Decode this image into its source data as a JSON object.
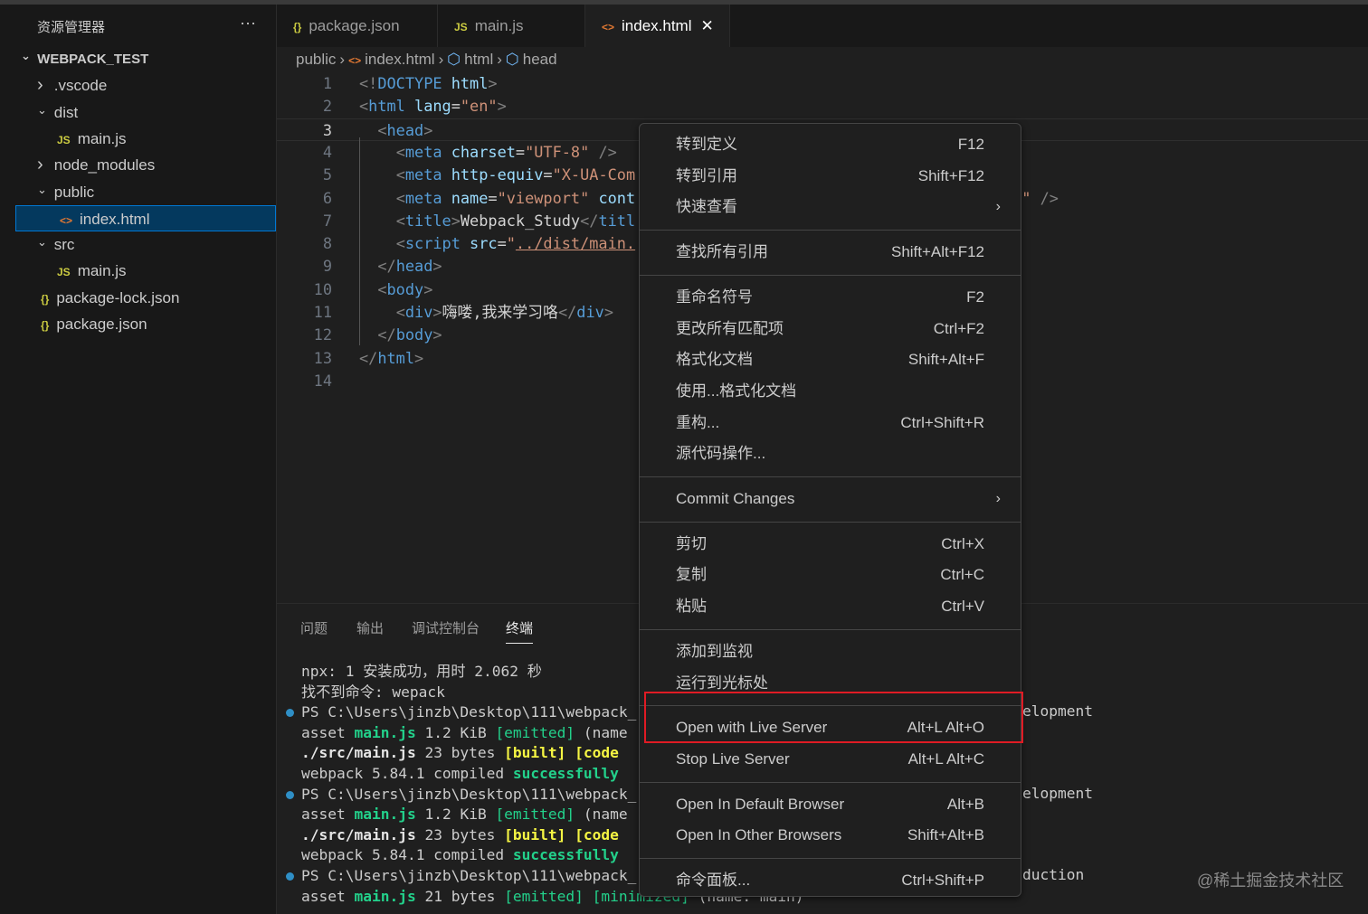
{
  "sidebar": {
    "title": "资源管理器",
    "more": "···",
    "tree": [
      {
        "label": "WEBPACK_TEST",
        "chevron": "down",
        "indent": 0,
        "root": true
      },
      {
        "label": ".vscode",
        "chevron": "right",
        "indent": 1
      },
      {
        "label": "dist",
        "chevron": "down",
        "indent": 1
      },
      {
        "label": "main.js",
        "icon": "JS",
        "iconType": "js",
        "indent": 2
      },
      {
        "label": "node_modules",
        "chevron": "right",
        "indent": 1
      },
      {
        "label": "public",
        "chevron": "down",
        "indent": 1
      },
      {
        "label": "index.html",
        "icon": "<>",
        "iconType": "html",
        "indent": 2,
        "selected": true
      },
      {
        "label": "src",
        "chevron": "down",
        "indent": 1
      },
      {
        "label": "main.js",
        "icon": "JS",
        "iconType": "js",
        "indent": 2
      },
      {
        "label": "package-lock.json",
        "icon": "{}",
        "iconType": "json",
        "indent": 1
      },
      {
        "label": "package.json",
        "icon": "{}",
        "iconType": "json",
        "indent": 1
      }
    ]
  },
  "tabs": [
    {
      "label": "package.json",
      "icon": "{}",
      "iconType": "json"
    },
    {
      "label": "main.js",
      "icon": "JS",
      "iconType": "js"
    },
    {
      "label": "index.html",
      "icon": "<>",
      "iconType": "html",
      "active": true,
      "close": "✕"
    }
  ],
  "breadcrumb": {
    "items": [
      "public",
      "index.html",
      "html",
      "head"
    ],
    "sep": "›"
  },
  "editor": {
    "current_line": 3,
    "lines": [
      [
        [
          "t-p",
          "<!"
        ],
        [
          "t-tag",
          "DOCTYPE"
        ],
        [
          "t-txt",
          " "
        ],
        [
          "t-attr",
          "html"
        ],
        [
          "t-p",
          ">"
        ]
      ],
      [
        [
          "t-p",
          "<"
        ],
        [
          "t-tag",
          "html"
        ],
        [
          "t-txt",
          " "
        ],
        [
          "t-attr",
          "lang"
        ],
        [
          "t-txt",
          "="
        ],
        [
          "t-str",
          "\"en\""
        ],
        [
          "t-p",
          ">"
        ]
      ],
      [
        [
          "t-txt",
          "  "
        ],
        [
          "t-p",
          "<"
        ],
        [
          "t-tag",
          "head"
        ],
        [
          "t-p",
          ">"
        ]
      ],
      [
        [
          "t-txt",
          "    "
        ],
        [
          "t-p",
          "<"
        ],
        [
          "t-tag",
          "meta"
        ],
        [
          "t-txt",
          " "
        ],
        [
          "t-attr",
          "charset"
        ],
        [
          "t-txt",
          "="
        ],
        [
          "t-str",
          "\"UTF-8\""
        ],
        [
          "t-txt",
          " "
        ],
        [
          "t-p",
          "/>"
        ]
      ],
      [
        [
          "t-txt",
          "    "
        ],
        [
          "t-p",
          "<"
        ],
        [
          "t-tag",
          "meta"
        ],
        [
          "t-txt",
          " "
        ],
        [
          "t-attr",
          "http-equiv"
        ],
        [
          "t-txt",
          "="
        ],
        [
          "t-str",
          "\"X-UA-Com"
        ]
      ],
      [
        [
          "t-txt",
          "    "
        ],
        [
          "t-p",
          "<"
        ],
        [
          "t-tag",
          "meta"
        ],
        [
          "t-txt",
          " "
        ],
        [
          "t-attr",
          "name"
        ],
        [
          "t-txt",
          "="
        ],
        [
          "t-str",
          "\"viewport\""
        ],
        [
          "t-txt",
          " "
        ],
        [
          "t-attr",
          "cont"
        ],
        [
          "t-txt",
          "                                         "
        ],
        [
          "t-str",
          "0\""
        ],
        [
          "t-txt",
          " "
        ],
        [
          "t-p",
          "/>"
        ]
      ],
      [
        [
          "t-txt",
          "    "
        ],
        [
          "t-p",
          "<"
        ],
        [
          "t-tag",
          "title"
        ],
        [
          "t-p",
          ">"
        ],
        [
          "t-txt",
          "Webpack_Study"
        ],
        [
          "t-p",
          "</"
        ],
        [
          "t-tag",
          "titl"
        ]
      ],
      [
        [
          "t-txt",
          "    "
        ],
        [
          "t-p",
          "<"
        ],
        [
          "t-tag",
          "script"
        ],
        [
          "t-txt",
          " "
        ],
        [
          "t-attr",
          "src"
        ],
        [
          "t-txt",
          "="
        ],
        [
          "t-str",
          "\""
        ],
        [
          "t-strU",
          "../dist/main."
        ]
      ],
      [
        [
          "t-txt",
          "  "
        ],
        [
          "t-p",
          "</"
        ],
        [
          "t-tag",
          "head"
        ],
        [
          "t-p",
          ">"
        ]
      ],
      [
        [
          "t-txt",
          "  "
        ],
        [
          "t-p",
          "<"
        ],
        [
          "t-tag",
          "body"
        ],
        [
          "t-p",
          ">"
        ]
      ],
      [
        [
          "t-txt",
          "    "
        ],
        [
          "t-p",
          "<"
        ],
        [
          "t-tag",
          "div"
        ],
        [
          "t-p",
          ">"
        ],
        [
          "t-txt",
          "嗨喽,我来学习咯"
        ],
        [
          "t-p",
          "</"
        ],
        [
          "t-tag",
          "div"
        ],
        [
          "t-p",
          ">"
        ]
      ],
      [
        [
          "t-txt",
          "  "
        ],
        [
          "t-p",
          "</"
        ],
        [
          "t-tag",
          "body"
        ],
        [
          "t-p",
          ">"
        ]
      ],
      [
        [
          "t-p",
          "</"
        ],
        [
          "t-tag",
          "html"
        ],
        [
          "t-p",
          ">"
        ]
      ],
      []
    ]
  },
  "panel": {
    "tabs": [
      "问题",
      "输出",
      "调试控制台",
      "终端"
    ],
    "active_tab": "终端",
    "terminal": [
      {
        "parts": [
          [
            "",
            "npx: 1 安装成功，用时 2.062 秒"
          ]
        ]
      },
      {
        "parts": [
          [
            "",
            "找不到命令: wepack"
          ]
        ]
      },
      {
        "dot": true,
        "parts": [
          [
            "",
            "PS C:\\Users\\jinzb\\Desktop\\111\\webpack_"
          ]
        ],
        "right": "elopment"
      },
      {
        "parts": [
          [
            "",
            "asset "
          ],
          [
            "g",
            "main.js"
          ],
          [
            "",
            " 1.2 KiB "
          ],
          [
            "gb",
            "[emitted]"
          ],
          [
            "",
            " (name"
          ]
        ]
      },
      {
        "parts": [
          [
            "b",
            "./src/main.js"
          ],
          [
            "",
            " 23 bytes "
          ],
          [
            "y",
            "[built]"
          ],
          [
            "",
            " "
          ],
          [
            "y",
            "[code"
          ]
        ]
      },
      {
        "parts": [
          [
            "",
            "webpack 5.84.1 compiled "
          ],
          [
            "g",
            "successfully"
          ]
        ]
      },
      {
        "dot": true,
        "parts": [
          [
            "",
            "PS C:\\Users\\jinzb\\Desktop\\111\\webpack_"
          ]
        ],
        "right": "elopment"
      },
      {
        "parts": [
          [
            "",
            "asset "
          ],
          [
            "g",
            "main.js"
          ],
          [
            "",
            " 1.2 KiB "
          ],
          [
            "gb",
            "[emitted]"
          ],
          [
            "",
            " (name"
          ]
        ]
      },
      {
        "parts": [
          [
            "b",
            "./src/main.js"
          ],
          [
            "",
            " 23 bytes "
          ],
          [
            "y",
            "[built]"
          ],
          [
            "",
            " "
          ],
          [
            "y",
            "[code"
          ]
        ]
      },
      {
        "parts": [
          [
            "",
            "webpack 5.84.1 compiled "
          ],
          [
            "g",
            "successfully"
          ]
        ]
      },
      {
        "dot": true,
        "parts": [
          [
            "",
            "PS C:\\Users\\jinzb\\Desktop\\111\\webpack_"
          ]
        ],
        "right": "duction"
      },
      {
        "parts": [
          [
            "",
            "asset "
          ],
          [
            "g",
            "main.js"
          ],
          [
            "",
            " 21 bytes "
          ],
          [
            "gb",
            "[emitted]"
          ],
          [
            "",
            " "
          ],
          [
            "gb",
            "[minimized]"
          ],
          [
            "",
            " (name: main)"
          ]
        ]
      }
    ]
  },
  "context_menu": {
    "groups": [
      [
        {
          "label": "转到定义",
          "key": "F12"
        },
        {
          "label": "转到引用",
          "key": "Shift+F12"
        },
        {
          "label": "快速查看",
          "submenu": true
        }
      ],
      [
        {
          "label": "查找所有引用",
          "key": "Shift+Alt+F12"
        }
      ],
      [
        {
          "label": "重命名符号",
          "key": "F2"
        },
        {
          "label": "更改所有匹配项",
          "key": "Ctrl+F2"
        },
        {
          "label": "格式化文档",
          "key": "Shift+Alt+F"
        },
        {
          "label": "使用...格式化文档"
        },
        {
          "label": "重构...",
          "key": "Ctrl+Shift+R"
        },
        {
          "label": "源代码操作..."
        }
      ],
      [
        {
          "label": "Commit Changes",
          "submenu": true
        }
      ],
      [
        {
          "label": "剪切",
          "key": "Ctrl+X"
        },
        {
          "label": "复制",
          "key": "Ctrl+C"
        },
        {
          "label": "粘贴",
          "key": "Ctrl+V"
        }
      ],
      [
        {
          "label": "添加到监视"
        },
        {
          "label": "运行到光标处"
        }
      ],
      [
        {
          "label": "Open with Live Server",
          "key": "Alt+L Alt+O",
          "highlighted": true
        },
        {
          "label": "Stop Live Server",
          "key": "Alt+L Alt+C"
        }
      ],
      [
        {
          "label": "Open In Default Browser",
          "key": "Alt+B"
        },
        {
          "label": "Open In Other Browsers",
          "key": "Shift+Alt+B"
        }
      ],
      [
        {
          "label": "命令面板...",
          "key": "Ctrl+Shift+P"
        }
      ]
    ],
    "highlight_color": "#e01b24"
  },
  "watermark": "@稀土掘金技术社区"
}
